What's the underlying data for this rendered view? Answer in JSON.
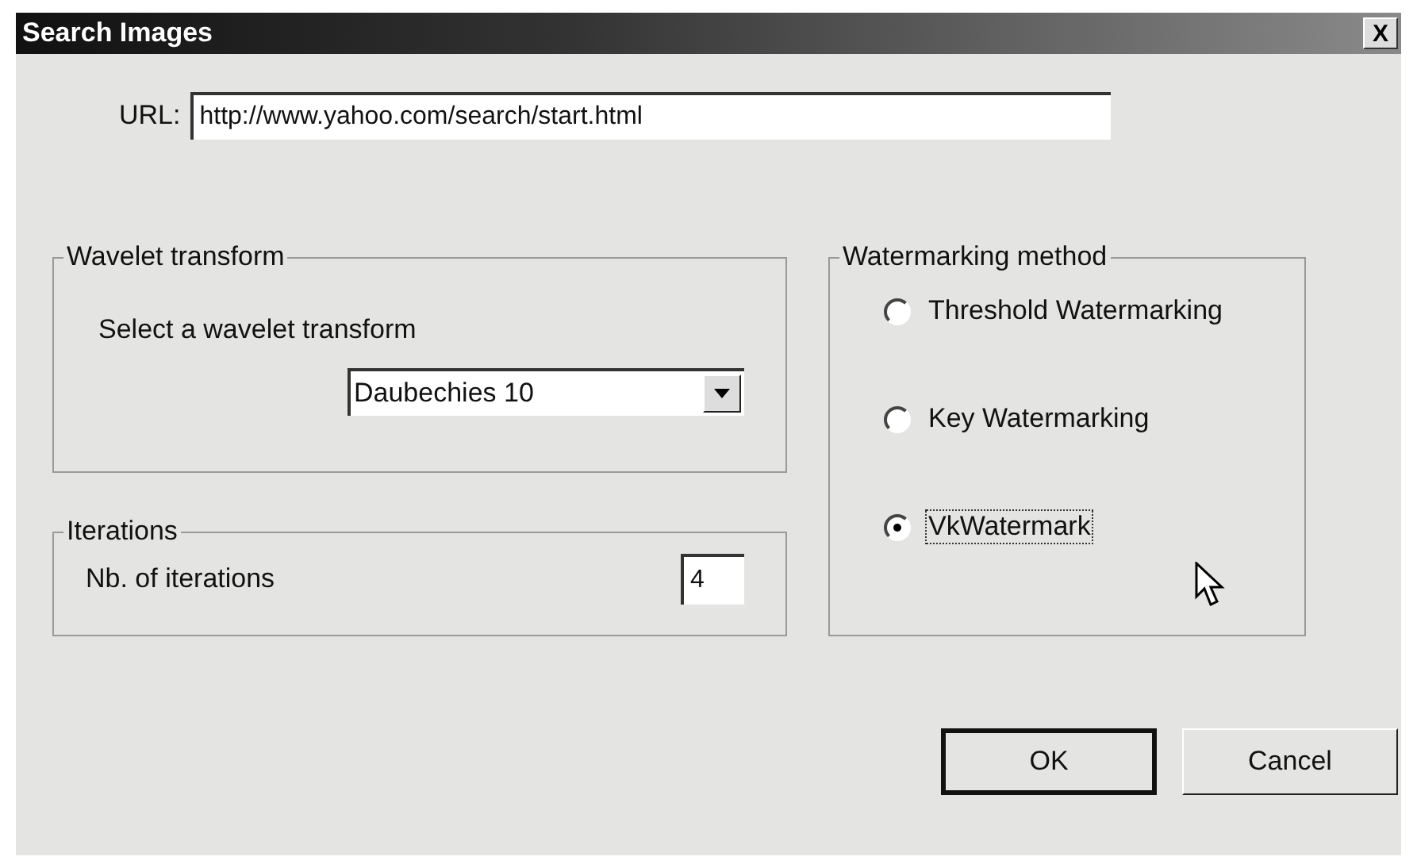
{
  "window": {
    "title": "Search Images",
    "close": "X"
  },
  "url": {
    "label": "URL:",
    "value": "http://www.yahoo.com/search/start.html"
  },
  "wavelet_group": {
    "title": "Wavelet transform",
    "prompt": "Select a wavelet transform",
    "value": "Daubechies 10"
  },
  "iterations_group": {
    "title": "Iterations",
    "label": "Nb. of iterations",
    "value": "4"
  },
  "watermarking_group": {
    "title": "Watermarking method",
    "options": [
      {
        "label": "Threshold Watermarking",
        "selected": false
      },
      {
        "label": "Key Watermarking",
        "selected": false
      },
      {
        "label": "VkWatermark",
        "selected": true
      }
    ]
  },
  "buttons": [
    {
      "label": "OK",
      "default": true
    },
    {
      "label": "Cancel",
      "default": false
    }
  ]
}
